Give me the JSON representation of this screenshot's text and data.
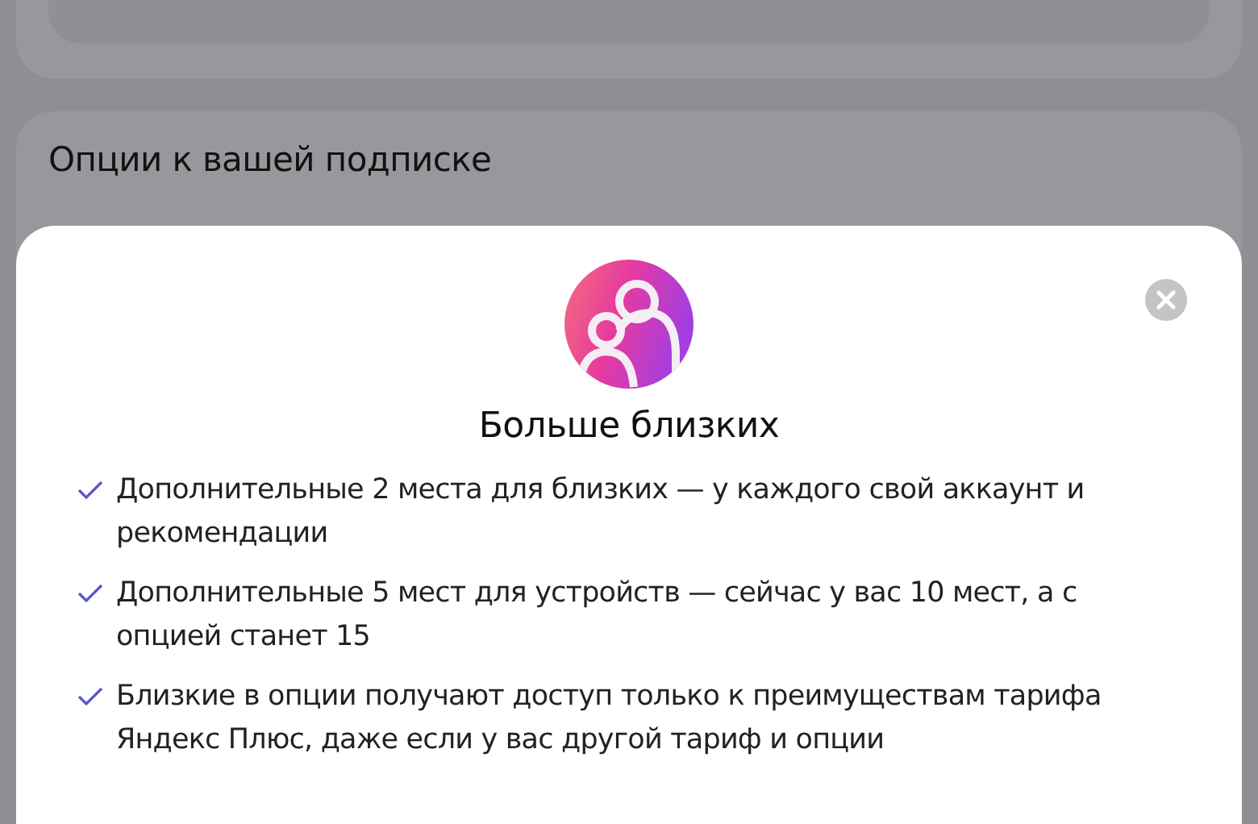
{
  "section": {
    "title": "Опции к вашей подписке"
  },
  "modal": {
    "title": "Больше близких",
    "features": [
      {
        "text": "Дополнительные 2 места для близких — у каждого свой аккаунт и рекомендации"
      },
      {
        "text": "Дополнительные 5 мест для устройств — сейчас у вас 10 мест, а с опцией станет 15"
      },
      {
        "text": "Близкие в опции получают доступ только к преимуществам тарифа Яндекс Плюс, даже если у вас другой тариф и опции"
      }
    ]
  }
}
